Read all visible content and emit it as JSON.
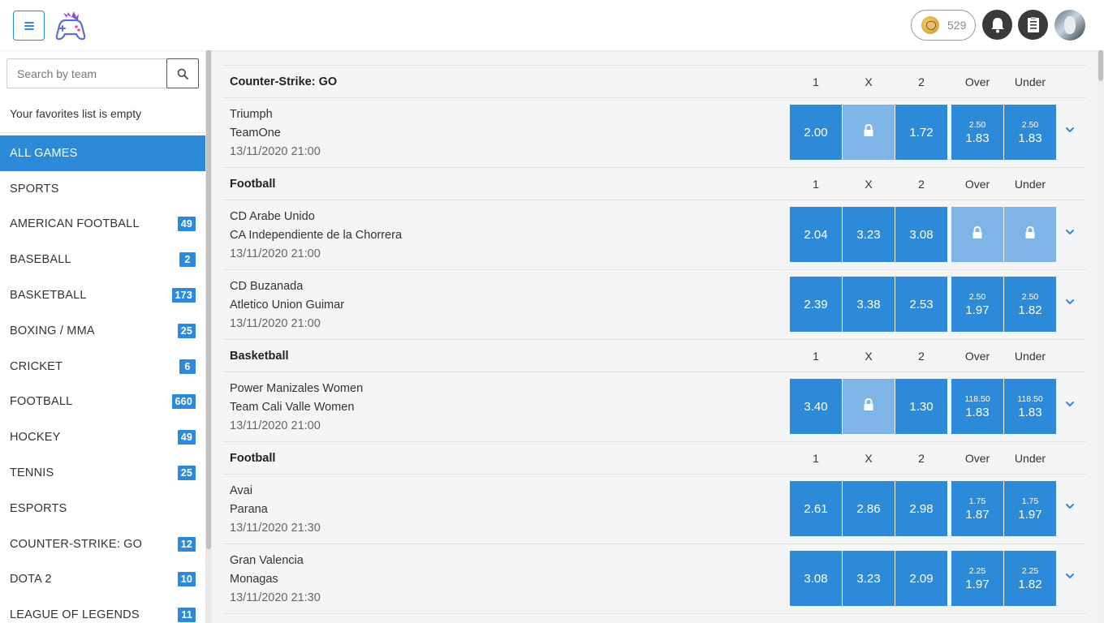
{
  "header": {
    "coin_count": "529",
    "icons": {
      "menu": "hamburger-icon",
      "logo": "gamepad-logo",
      "coin": "doge-coin-icon",
      "bell": "bell-icon",
      "slip": "betslip-icon"
    }
  },
  "colors": {
    "accent": "#2d8ad8",
    "locked": "#7eb4e6",
    "dark_button": "#3a3a3a"
  },
  "sidebar": {
    "search_placeholder": "Search by team",
    "favorites_empty": "Your favorites list is empty",
    "items": [
      {
        "label": "ALL GAMES",
        "count": null,
        "active": true
      },
      {
        "label": "SPORTS",
        "count": null
      },
      {
        "label": "AMERICAN FOOTBALL",
        "count": "49"
      },
      {
        "label": "BASEBALL",
        "count": "2"
      },
      {
        "label": "BASKETBALL",
        "count": "173"
      },
      {
        "label": "BOXING / MMA",
        "count": "25"
      },
      {
        "label": "CRICKET",
        "count": "6"
      },
      {
        "label": "FOOTBALL",
        "count": "660"
      },
      {
        "label": "HOCKEY",
        "count": "49"
      },
      {
        "label": "TENNIS",
        "count": "25"
      },
      {
        "label": "ESPORTS",
        "count": null
      },
      {
        "label": "COUNTER-STRIKE: GO",
        "count": "12"
      },
      {
        "label": "DOTA 2",
        "count": "10"
      },
      {
        "label": "LEAGUE OF LEGENDS",
        "count": "11"
      }
    ]
  },
  "columns": [
    "1",
    "X",
    "2",
    "Over",
    "Under"
  ],
  "groups": [
    {
      "title": "Counter-Strike: GO",
      "events": [
        {
          "team1": "Triumph",
          "team2": "TeamOne",
          "time": "13/11/2020 21:00",
          "odds": {
            "home": "2.00",
            "draw": null,
            "away": "1.72",
            "over_line": "2.50",
            "over": "1.83",
            "under_line": "2.50",
            "under": "1.83"
          }
        }
      ]
    },
    {
      "title": "Football",
      "events": [
        {
          "team1": "CD Arabe Unido",
          "team2": "CA Independiente de la Chorrera",
          "time": "13/11/2020 21:00",
          "odds": {
            "home": "2.04",
            "draw": "3.23",
            "away": "3.08",
            "over_line": null,
            "over": null,
            "under_line": null,
            "under": null
          }
        },
        {
          "team1": "CD Buzanada",
          "team2": "Atletico Union Guimar",
          "time": "13/11/2020 21:00",
          "odds": {
            "home": "2.39",
            "draw": "3.38",
            "away": "2.53",
            "over_line": "2.50",
            "over": "1.97",
            "under_line": "2.50",
            "under": "1.82"
          }
        }
      ]
    },
    {
      "title": "Basketball",
      "events": [
        {
          "team1": "Power Manizales Women",
          "team2": "Team Cali Valle Women",
          "time": "13/11/2020 21:00",
          "odds": {
            "home": "3.40",
            "draw": null,
            "away": "1.30",
            "over_line": "118.50",
            "over": "1.83",
            "under_line": "118.50",
            "under": "1.83"
          }
        }
      ]
    },
    {
      "title": "Football",
      "events": [
        {
          "team1": "Avai",
          "team2": "Parana",
          "time": "13/11/2020 21:30",
          "odds": {
            "home": "2.61",
            "draw": "2.86",
            "away": "2.98",
            "over_line": "1.75",
            "over": "1.87",
            "under_line": "1.75",
            "under": "1.97"
          }
        },
        {
          "team1": "Gran Valencia",
          "team2": "Monagas",
          "time": "13/11/2020 21:30",
          "odds": {
            "home": "3.08",
            "draw": "3.23",
            "away": "2.09",
            "over_line": "2.25",
            "over": "1.97",
            "under_line": "2.25",
            "under": "1.82"
          }
        }
      ]
    }
  ]
}
